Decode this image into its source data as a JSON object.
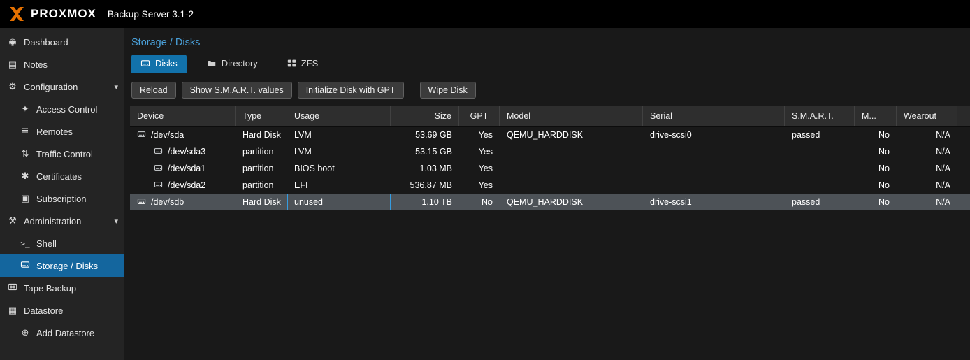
{
  "topbar": {
    "brand": "PROXMOX",
    "subtitle": "Backup Server 3.1-2"
  },
  "colors": {
    "brand_orange": "#e57000",
    "accent_blue": "#1272ab",
    "sidebar_selected_blue": "#14669e",
    "title_blue": "#4aa0d9",
    "selected_row_gray": "#4d5257"
  },
  "icons": {
    "dashboard": "◉",
    "notes": "▤",
    "configuration": "⚙",
    "access_control": "✦",
    "remotes": "≣",
    "traffic_control": "⇅",
    "certificates": "✱",
    "subscription": "▣",
    "administration": "⚒",
    "shell": ">_",
    "datastore": "▦",
    "add_datastore": "⊕",
    "caret_down": "▾"
  },
  "sidebar": {
    "items": [
      {
        "label": "Dashboard"
      },
      {
        "label": "Notes"
      },
      {
        "label": "Configuration"
      },
      {
        "label": "Access Control"
      },
      {
        "label": "Remotes"
      },
      {
        "label": "Traffic Control"
      },
      {
        "label": "Certificates"
      },
      {
        "label": "Subscription"
      },
      {
        "label": "Administration"
      },
      {
        "label": "Shell"
      },
      {
        "label": "Storage / Disks"
      },
      {
        "label": "Tape Backup"
      },
      {
        "label": "Datastore"
      },
      {
        "label": "Add Datastore"
      }
    ]
  },
  "main": {
    "title": "Storage / Disks",
    "tabs": [
      {
        "label": "Disks"
      },
      {
        "label": "Directory"
      },
      {
        "label": "ZFS"
      }
    ],
    "toolbar": {
      "reload": "Reload",
      "smart": "Show S.M.A.R.T. values",
      "init_gpt": "Initialize Disk with GPT",
      "wipe": "Wipe Disk"
    },
    "table": {
      "columns": [
        "Device",
        "Type",
        "Usage",
        "Size",
        "GPT",
        "Model",
        "Serial",
        "S.M.A.R.T.",
        "M...",
        "Wearout"
      ],
      "rows": [
        {
          "device": "/dev/sda",
          "type": "Hard Disk",
          "usage": "LVM",
          "size": "53.69 GB",
          "gpt": "Yes",
          "model": "QEMU_HARDDISK",
          "serial": "drive-scsi0",
          "smart": "passed",
          "mounted": "No",
          "wearout": "N/A"
        },
        {
          "device": "/dev/sda3",
          "type": "partition",
          "usage": "LVM",
          "size": "53.15 GB",
          "gpt": "Yes",
          "model": "",
          "serial": "",
          "smart": "",
          "mounted": "No",
          "wearout": "N/A"
        },
        {
          "device": "/dev/sda1",
          "type": "partition",
          "usage": "BIOS boot",
          "size": "1.03 MB",
          "gpt": "Yes",
          "model": "",
          "serial": "",
          "smart": "",
          "mounted": "No",
          "wearout": "N/A"
        },
        {
          "device": "/dev/sda2",
          "type": "partition",
          "usage": "EFI",
          "size": "536.87 MB",
          "gpt": "Yes",
          "model": "",
          "serial": "",
          "smart": "",
          "mounted": "No",
          "wearout": "N/A"
        },
        {
          "device": "/dev/sdb",
          "type": "Hard Disk",
          "usage": "unused",
          "size": "1.10 TB",
          "gpt": "No",
          "model": "QEMU_HARDDISK",
          "serial": "drive-scsi1",
          "smart": "passed",
          "mounted": "No",
          "wearout": "N/A"
        }
      ]
    }
  }
}
